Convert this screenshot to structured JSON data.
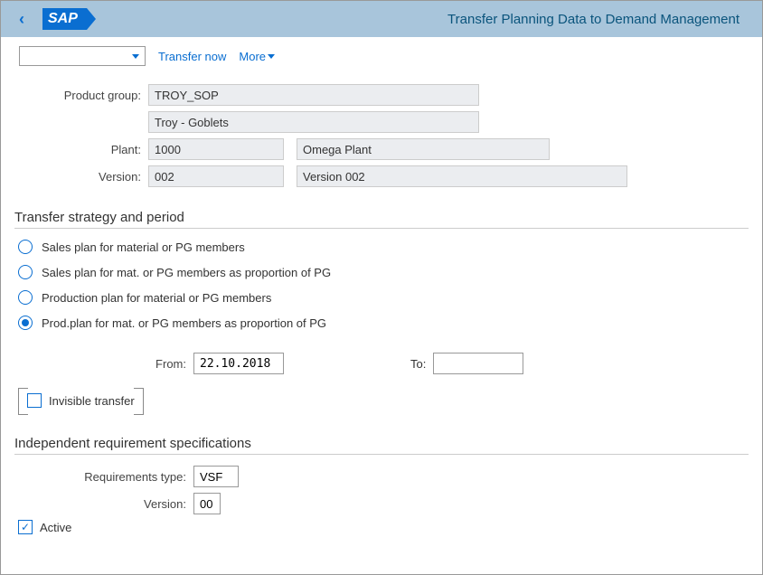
{
  "header": {
    "title": "Transfer Planning Data to Demand Management",
    "logo_text": "SAP"
  },
  "toolbar": {
    "transfer_now": "Transfer now",
    "more": "More"
  },
  "basic": {
    "product_group_label": "Product group:",
    "product_group_value": "TROY_SOP",
    "product_group_desc": "Troy - Goblets",
    "plant_label": "Plant:",
    "plant_value": "1000",
    "plant_desc": "Omega Plant",
    "version_label": "Version:",
    "version_value": "002",
    "version_desc": "Version 002"
  },
  "strategy": {
    "title": "Transfer strategy and period",
    "options": [
      "Sales plan for material or PG members",
      "Sales plan for mat. or PG members as proportion of PG",
      "Production plan for material or PG members",
      "Prod.plan for mat. or PG members as proportion of PG"
    ],
    "selected_index": 3,
    "from_label": "From:",
    "from_value": "22.10.2018",
    "to_label": "To:",
    "to_value": "",
    "invisible_transfer_label": "Invisible transfer",
    "invisible_transfer_checked": false
  },
  "independent": {
    "title": "Independent requirement specifications",
    "req_type_label": "Requirements type:",
    "req_type_value": "VSF",
    "version_label": "Version:",
    "version_value": "00",
    "active_label": "Active",
    "active_checked": true
  }
}
